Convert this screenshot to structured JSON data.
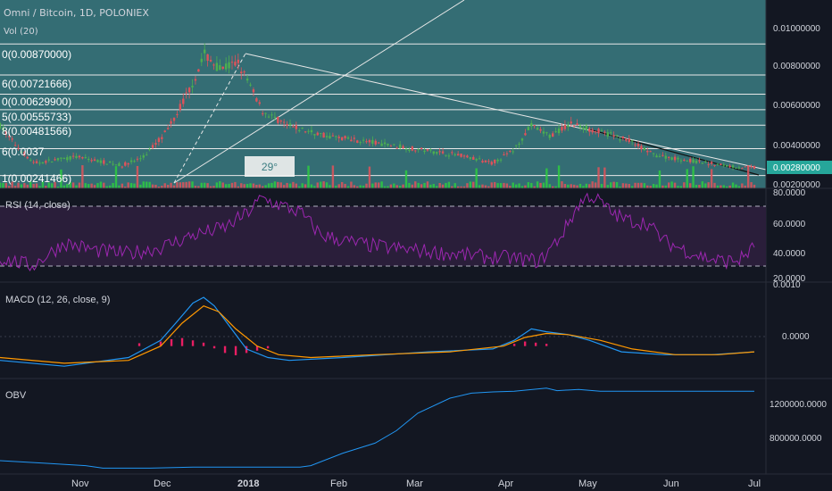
{
  "header": {
    "title": "Omni / Bitcoin, 1D, POLONIEX",
    "volume_label": "Vol (20)"
  },
  "colors": {
    "background": "#131722",
    "price_bg": "#3b7d82",
    "up": "#4caf50",
    "down": "#e0525a",
    "rsi_line": "#9c27b0",
    "macd_line": "#2196f3",
    "signal_line": "#ff9800",
    "histogram": "#e91e63",
    "obv_line": "#2196f3",
    "current_price_badge": "#26a69a"
  },
  "price_axis": {
    "ticks": [
      "0.01000000",
      "0.00800000",
      "0.00600000",
      "0.00400000",
      "0.00280000",
      "0.00200000"
    ],
    "current": "0.00280000"
  },
  "fib_labels": [
    "0(0.00870000)",
    "6(0.00721666)",
    "0(0.00629900)",
    "5(0.00555733)",
    "8(0.00481566)",
    "6(0.0037",
    "1(0.00241466)"
  ],
  "angle_label": "29°",
  "rsi": {
    "label": "RSI (14, close)",
    "ticks": [
      "80.0000",
      "60.0000",
      "40.0000",
      "20.0000"
    ]
  },
  "macd": {
    "label": "MACD (12, 26, close, 9)",
    "ticks": [
      "0.0010",
      "0.0000"
    ]
  },
  "obv": {
    "label": "OBV",
    "ticks": [
      "1200000.0000",
      "800000.0000"
    ]
  },
  "time_axis": [
    "Nov",
    "Dec",
    "2018",
    "Feb",
    "Mar",
    "Apr",
    "May",
    "Jun",
    "Jul"
  ],
  "chart_data": [
    {
      "type": "candlestick",
      "title": "Omni / Bitcoin, 1D, POLONIEX",
      "x_range": [
        "2017-10-26",
        "2018-06-30"
      ],
      "ylim": [
        0.0018,
        0.0108
      ],
      "fib_levels": [
        0.0087,
        0.00721666,
        0.006299,
        0.00555733,
        0.00481566,
        0.0037,
        0.00241466
      ],
      "keypoints": [
        {
          "x": "2017-10-26",
          "y": 0.0048
        },
        {
          "x": "2017-10-31",
          "y": 0.0039
        },
        {
          "x": "2017-11-06",
          "y": 0.003
        },
        {
          "x": "2017-11-20",
          "y": 0.0033
        },
        {
          "x": "2017-12-05",
          "y": 0.0029
        },
        {
          "x": "2017-12-12",
          "y": 0.0033
        },
        {
          "x": "2017-12-20",
          "y": 0.0046
        },
        {
          "x": "2017-12-28",
          "y": 0.0068
        },
        {
          "x": "2018-01-01",
          "y": 0.0082
        },
        {
          "x": "2018-01-06",
          "y": 0.0075
        },
        {
          "x": "2018-01-12",
          "y": 0.0078
        },
        {
          "x": "2018-01-20",
          "y": 0.0055
        },
        {
          "x": "2018-01-28",
          "y": 0.0048
        },
        {
          "x": "2018-02-10",
          "y": 0.0043
        },
        {
          "x": "2018-02-25",
          "y": 0.004
        },
        {
          "x": "2018-03-10",
          "y": 0.0037
        },
        {
          "x": "2018-03-25",
          "y": 0.0034
        },
        {
          "x": "2018-04-05",
          "y": 0.003
        },
        {
          "x": "2018-04-12",
          "y": 0.0036
        },
        {
          "x": "2018-04-18",
          "y": 0.0048
        },
        {
          "x": "2018-04-24",
          "y": 0.0043
        },
        {
          "x": "2018-05-01",
          "y": 0.0049
        },
        {
          "x": "2018-05-08",
          "y": 0.0046
        },
        {
          "x": "2018-05-20",
          "y": 0.0041
        },
        {
          "x": "2018-05-28",
          "y": 0.0034
        },
        {
          "x": "2018-06-10",
          "y": 0.0031
        },
        {
          "x": "2018-06-20",
          "y": 0.0029
        },
        {
          "x": "2018-06-26",
          "y": 0.0028
        }
      ]
    },
    {
      "type": "line",
      "title": "RSI (14, close)",
      "ylim": [
        20,
        80
      ],
      "bands": [
        70,
        30
      ],
      "points": [
        [
          0,
          35
        ],
        [
          15,
          30
        ],
        [
          30,
          45
        ],
        [
          45,
          40
        ],
        [
          60,
          38
        ],
        [
          75,
          42
        ],
        [
          90,
          50
        ],
        [
          105,
          55
        ],
        [
          115,
          64
        ],
        [
          122,
          74
        ],
        [
          130,
          70
        ],
        [
          140,
          65
        ],
        [
          150,
          50
        ],
        [
          165,
          45
        ],
        [
          180,
          42
        ],
        [
          195,
          40
        ],
        [
          210,
          38
        ],
        [
          225,
          36
        ],
        [
          240,
          35
        ],
        [
          252,
          33
        ],
        [
          262,
          50
        ],
        [
          270,
          70
        ],
        [
          275,
          76
        ],
        [
          280,
          72
        ],
        [
          285,
          65
        ],
        [
          292,
          60
        ],
        [
          302,
          58
        ],
        [
          310,
          46
        ],
        [
          320,
          40
        ],
        [
          330,
          35
        ],
        [
          338,
          33
        ],
        [
          345,
          34
        ],
        [
          352,
          42
        ]
      ]
    },
    {
      "type": "line",
      "title": "MACD (12, 26, close, 9)",
      "ylim": [
        -0.00055,
        0.0011
      ],
      "series": [
        {
          "points": [
            [
              0,
              -0.00025
            ],
            [
              30,
              -0.00035
            ],
            [
              60,
              -0.0002
            ],
            [
              75,
              0.0001
            ],
            [
              82,
              0.0004
            ],
            [
              90,
              0.00075
            ],
            [
              95,
              0.00085
            ],
            [
              100,
              0.0007
            ],
            [
              108,
              0.0003
            ],
            [
              115,
              -5e-05
            ],
            [
              125,
              -0.0002
            ],
            [
              135,
              -0.00025
            ],
            [
              160,
              -0.0002
            ],
            [
              200,
              -0.0001
            ],
            [
              230,
              -5e-05
            ],
            [
              240,
              0.0001
            ],
            [
              248,
              0.0003
            ],
            [
              255,
              0.00025
            ],
            [
              265,
              0.0002
            ],
            [
              275,
              0.0001
            ],
            [
              290,
              -0.0001
            ],
            [
              310,
              -0.00015
            ],
            [
              332,
              -0.00015
            ],
            [
              352,
              -0.0001
            ]
          ]
        },
        {
          "points": [
            [
              0,
              -0.0002
            ],
            [
              30,
              -0.0003
            ],
            [
              60,
              -0.00025
            ],
            [
              75,
              0.0
            ],
            [
              85,
              0.0004
            ],
            [
              95,
              0.0007
            ],
            [
              102,
              0.0006
            ],
            [
              110,
              0.0003
            ],
            [
              120,
              0.0
            ],
            [
              130,
              -0.00015
            ],
            [
              145,
              -0.0002
            ],
            [
              175,
              -0.00015
            ],
            [
              210,
              -0.0001
            ],
            [
              235,
              0.0
            ],
            [
              245,
              0.00015
            ],
            [
              255,
              0.00022
            ],
            [
              265,
              0.0002
            ],
            [
              280,
              0.0001
            ],
            [
              295,
              -5e-05
            ],
            [
              315,
              -0.00015
            ],
            [
              335,
              -0.00015
            ],
            [
              352,
              -0.0001
            ]
          ]
        }
      ],
      "histogram": [
        [
          65,
          5e-05
        ],
        [
          75,
          8e-05
        ],
        [
          80,
          0.00012
        ],
        [
          85,
          0.00014
        ],
        [
          90,
          0.0001
        ],
        [
          95,
          6e-05
        ],
        [
          100,
          -4e-05
        ],
        [
          105,
          -0.00012
        ],
        [
          110,
          -0.00016
        ],
        [
          115,
          -0.00012
        ],
        [
          120,
          -8e-05
        ],
        [
          125,
          -4e-05
        ],
        [
          240,
          4e-05
        ],
        [
          245,
          8e-05
        ],
        [
          250,
          6e-05
        ],
        [
          255,
          4e-05
        ]
      ]
    },
    {
      "type": "line",
      "title": "OBV",
      "ylim": [
        600000,
        1350000
      ],
      "points": [
        [
          0,
          700000
        ],
        [
          20,
          680000
        ],
        [
          40,
          660000
        ],
        [
          48,
          640000
        ],
        [
          70,
          640000
        ],
        [
          90,
          648000
        ],
        [
          105,
          648000
        ],
        [
          130,
          648000
        ],
        [
          140,
          648000
        ],
        [
          145,
          660000
        ],
        [
          160,
          760000
        ],
        [
          175,
          840000
        ],
        [
          185,
          940000
        ],
        [
          195,
          1080000
        ],
        [
          210,
          1200000
        ],
        [
          220,
          1240000
        ],
        [
          230,
          1250000
        ],
        [
          240,
          1255000
        ],
        [
          255,
          1280000
        ],
        [
          260,
          1260000
        ],
        [
          270,
          1270000
        ],
        [
          280,
          1255000
        ],
        [
          290,
          1255000
        ],
        [
          352,
          1255000
        ]
      ]
    }
  ]
}
